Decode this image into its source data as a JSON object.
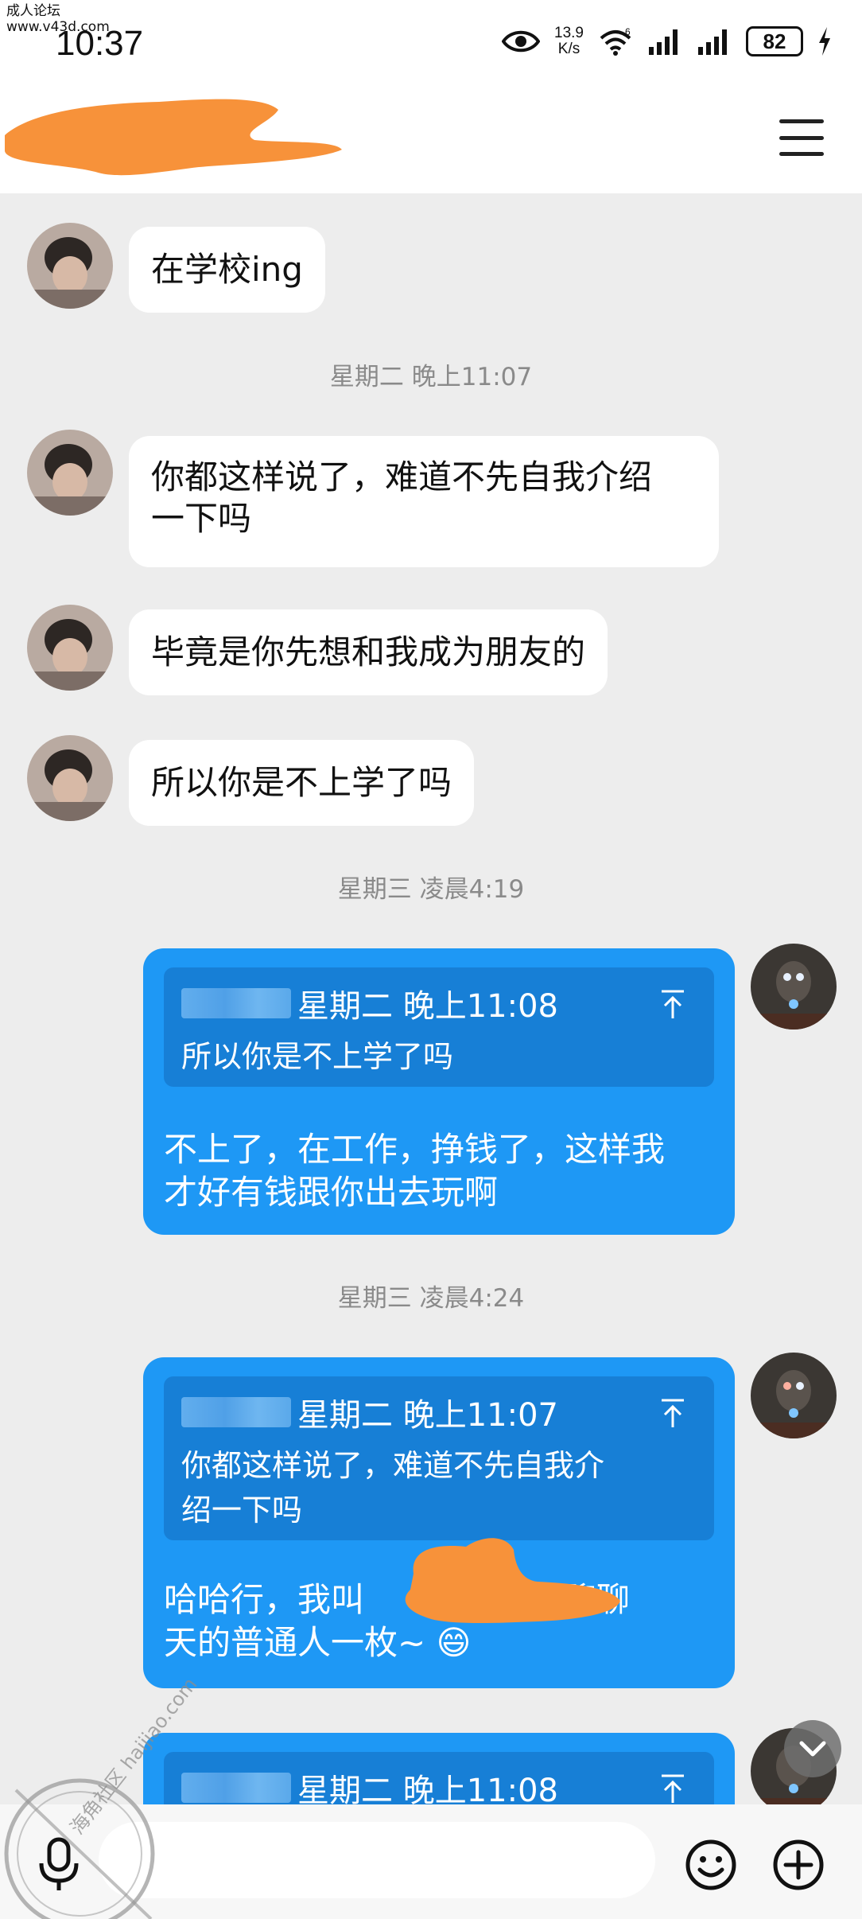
{
  "watermark_top": {
    "line1": "成人论坛",
    "line2": "www.v43d.com"
  },
  "status_bar": {
    "time": "10:37",
    "net_speed_value": "13.9",
    "net_speed_unit": "K/s",
    "wifi_label": "6",
    "battery": "82"
  },
  "header": {
    "chat_name": ""
  },
  "messages": [
    {
      "type": "in",
      "text": "在学校ing"
    },
    {
      "type": "time",
      "text": "星期二 晚上11:07"
    },
    {
      "type": "in",
      "line1": "你都这样说了，难道不先自我介绍",
      "line2": "一下吗"
    },
    {
      "type": "in",
      "text": "毕竟是你先想和我成为朋友的"
    },
    {
      "type": "in",
      "text": "所以你是不上学了吗"
    },
    {
      "type": "time",
      "text": "星期三 凌晨4:19"
    },
    {
      "type": "out",
      "quote_time": "星期二 晚上11:08",
      "quote_text": "所以你是不上学了吗",
      "line1": "不上了，在工作，挣钱了，这样我",
      "line2": "才好有钱跟你出去玩啊"
    },
    {
      "type": "time",
      "text": "星期三 凌晨4:24"
    },
    {
      "type": "out",
      "quote_time": "星期二 晚上11:07",
      "quote_line1": "你都这样说了，难道不先自我介",
      "quote_line2": "绍一下吗",
      "line1": "哈哈行，我叫",
      "line1b": "平时喜欢聊聊",
      "line2": "天的普通人一枚~",
      "emoji": "😄"
    },
    {
      "type": "out",
      "quote_time": "星期二 晚上11:08"
    }
  ],
  "input": {
    "placeholder": ""
  },
  "watermark_bottom": {
    "text": "海角社区 haijiao.com"
  },
  "colors": {
    "outgoing_bubble": "#1e98f5",
    "quote_bg": "#177fd6",
    "redaction": "#f7923a",
    "background": "#ededed"
  },
  "icons": [
    "eye-icon",
    "wifi-icon",
    "signal-icon",
    "charging-icon",
    "menu-icon",
    "avatar-contact",
    "avatar-self",
    "pin-top-icon",
    "chevron-down-icon",
    "mic-icon",
    "emoji-icon",
    "plus-icon"
  ]
}
